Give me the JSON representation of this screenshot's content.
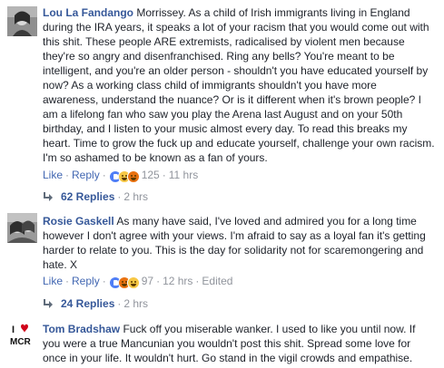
{
  "comments": [
    {
      "author": "Lou La Fandango",
      "text": "Morrissey. As a child of Irish immigrants living in England during the IRA years, it speaks a lot of your racism that you would come out with this shit. These people ARE extremists, radicalised by violent men because they're so angry and disenfranchised. Ring any bells? You're meant to be intelligent, and you're an older person - shouldn't you have educated yourself by now? As a working class child of immigrants shouldn't you have more awareness, understand the nuance? Or is it different when it's brown people? I am a lifelong fan who saw you play the Arena last August and on your 50th birthday, and I listen to your music almost every day. To read this breaks my heart. Time to grow the fuck up and educate yourself, challenge your own racism. I'm so ashamed to be known as a fan of yours.",
      "like_label": "Like",
      "reply_label": "Reply",
      "reaction_count": "125",
      "time": "11 hrs",
      "edited": "",
      "replies_label": "62 Replies",
      "replies_time": "2 hrs"
    },
    {
      "author": "Rosie Gaskell",
      "text": "As many have said, I've loved and admired you for a long time however I don't agree with your views. I'm afraid to say as a loyal fan it's getting harder to relate to you. This is the day for solidarity not for scaremongering and hate. X",
      "like_label": "Like",
      "reply_label": "Reply",
      "reaction_count": "97",
      "time": "12 hrs",
      "edited": "Edited",
      "replies_label": "24 Replies",
      "replies_time": "2 hrs"
    },
    {
      "author": "Tom Bradshaw",
      "text": "Fuck off you miserable wanker. I used to like you until now. If you were a true Mancunian you wouldn't post this shit. Spread some love for once in your life. It wouldn't hurt. Go stand in the vigil crowds and empathise.",
      "avatar_line1": "I",
      "avatar_line2": "MCR"
    }
  ],
  "colors": {
    "link": "#365899",
    "action": "#4267b2",
    "meta": "#90949c",
    "text": "#1d2129",
    "heart": "#d0021b"
  }
}
